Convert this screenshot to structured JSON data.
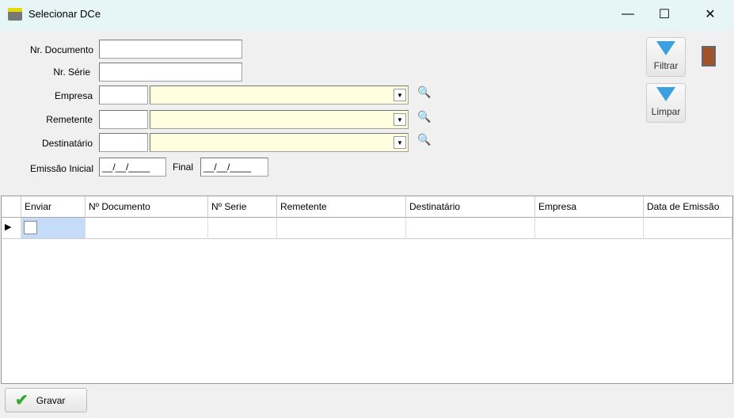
{
  "window": {
    "title": "Selecionar DCe",
    "min": "—",
    "max": "☐",
    "close": "✕"
  },
  "form": {
    "nr_documento_label": "Nr. Documento",
    "nr_documento_value": "",
    "nr_serie_label": "Nr. Série",
    "nr_serie_value": "",
    "empresa_label": "Empresa",
    "remetente_label": "Remetente",
    "destinatario_label": "Destinatário",
    "emissao_inicial_label": "Emissão Inicial",
    "emissao_inicial_value": "__/__/____",
    "final_label": "Final",
    "final_value": "__/__/____"
  },
  "toolbar": {
    "filtrar": "Filtrar",
    "limpar": "Limpar"
  },
  "grid": {
    "columns": [
      "Enviar",
      "Nº Documento",
      "Nº Serie",
      "Remetente",
      "Destinatário",
      "Empresa",
      "Data de Emissão"
    ]
  },
  "footer": {
    "gravar": "Gravar"
  }
}
